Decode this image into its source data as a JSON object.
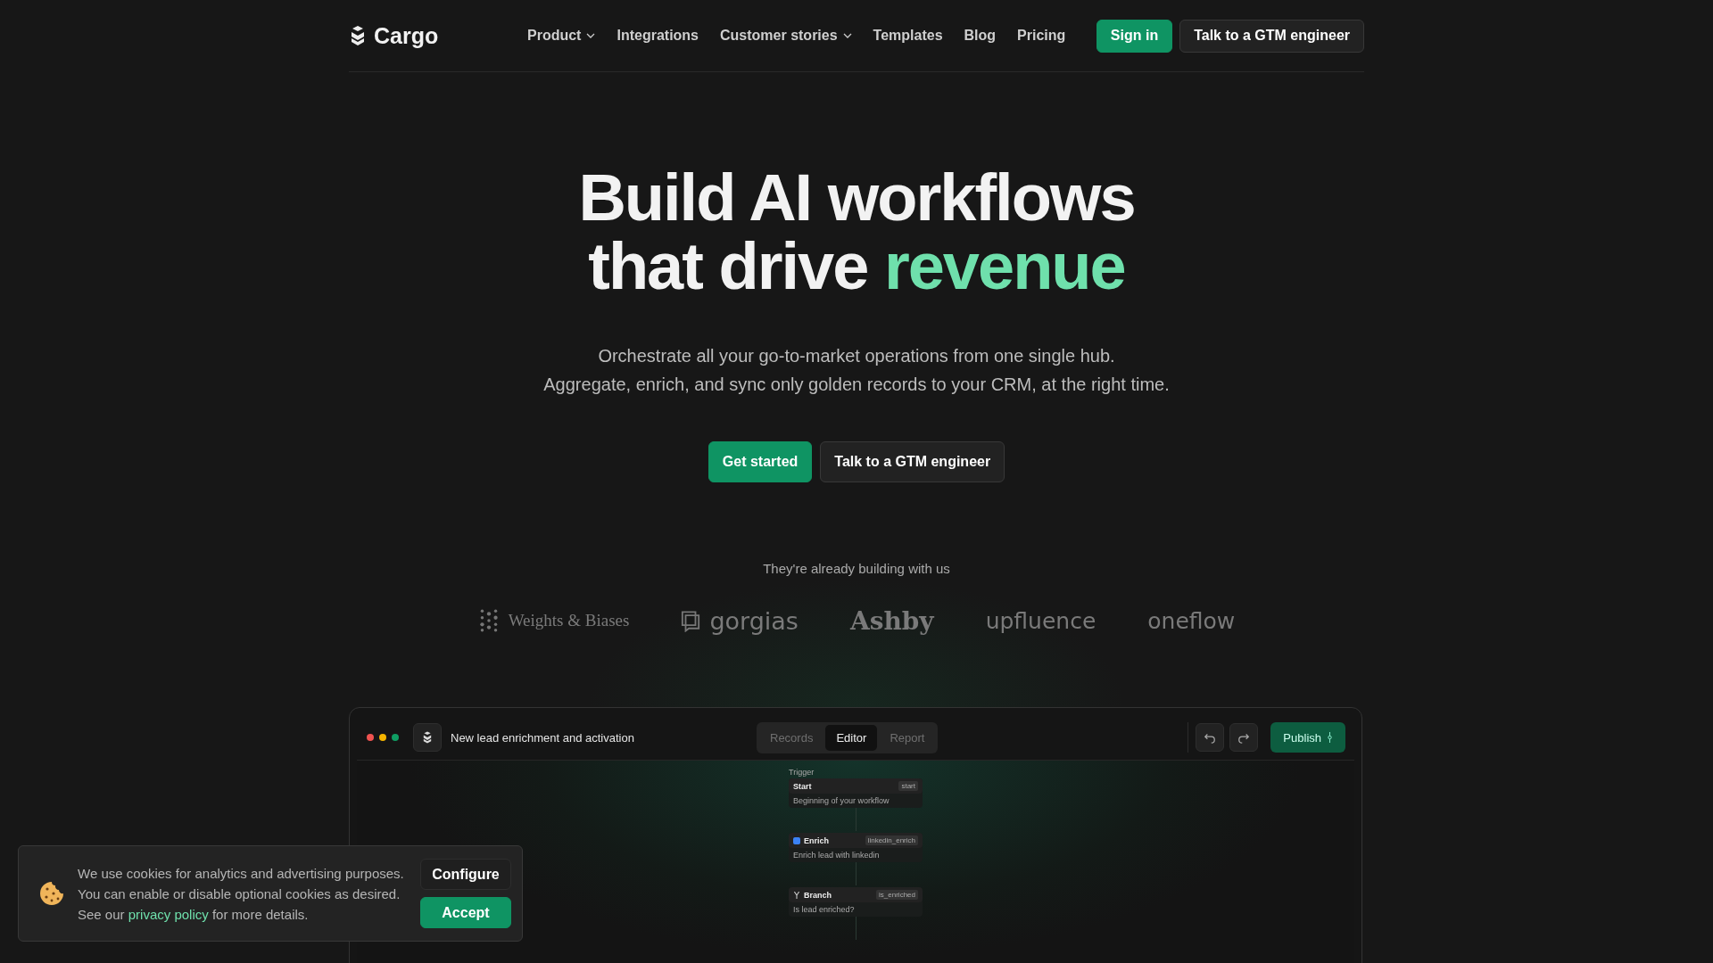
{
  "nav": {
    "brand": "Cargo",
    "links": [
      {
        "label": "Product",
        "dropdown": true
      },
      {
        "label": "Integrations",
        "dropdown": false
      },
      {
        "label": "Customer stories",
        "dropdown": true
      },
      {
        "label": "Templates",
        "dropdown": false
      },
      {
        "label": "Blog",
        "dropdown": false
      },
      {
        "label": "Pricing",
        "dropdown": false
      }
    ],
    "sign_in": "Sign in",
    "talk": "Talk to a GTM engineer"
  },
  "hero": {
    "title_line1": "Build AI workflows",
    "title_line2": "that drive",
    "title_highlight": "revenue",
    "subtitle_line1": "Orchestrate all your go-to-market operations from one single hub.",
    "subtitle_line2": "Aggregate, enrich, and sync only golden records to your CRM, at the right time.",
    "primary": "Get started",
    "secondary": "Talk to a GTM engineer"
  },
  "logos": {
    "caption": "They're already building with us",
    "items": [
      {
        "name": "Weights & Biases",
        "kind": "wandb"
      },
      {
        "name": "gorgias",
        "kind": "gorgias"
      },
      {
        "name": "Ashby",
        "kind": "ashby"
      },
      {
        "name": "upfluence",
        "kind": "upfluence"
      },
      {
        "name": "oneflow",
        "kind": "oneflow"
      }
    ]
  },
  "app": {
    "title": "New lead enrichment and activation",
    "tabs": [
      {
        "label": "Records",
        "selected": false
      },
      {
        "label": "Editor",
        "selected": true
      },
      {
        "label": "Report",
        "selected": false
      }
    ],
    "publish": "Publish",
    "trigger_label": "Trigger",
    "nodes": [
      {
        "kind": "start",
        "name": "Start",
        "tag": "start",
        "description": "Beginning of your workflow"
      },
      {
        "kind": "enrich",
        "name": "Enrich",
        "tag": "linkedin_enrich",
        "description": "Enrich lead with linkedin"
      },
      {
        "kind": "branch",
        "name": "Branch",
        "tag": "is_enriched",
        "description": "Is lead enriched?"
      }
    ]
  },
  "cookies": {
    "line1": "We use cookies for analytics and advertising purposes.",
    "line2": "You can enable or disable optional cookies as desired.",
    "line3_before": "See our",
    "link": "privacy policy",
    "line3_after": "for more details.",
    "configure": "Configure",
    "accept": "Accept"
  }
}
